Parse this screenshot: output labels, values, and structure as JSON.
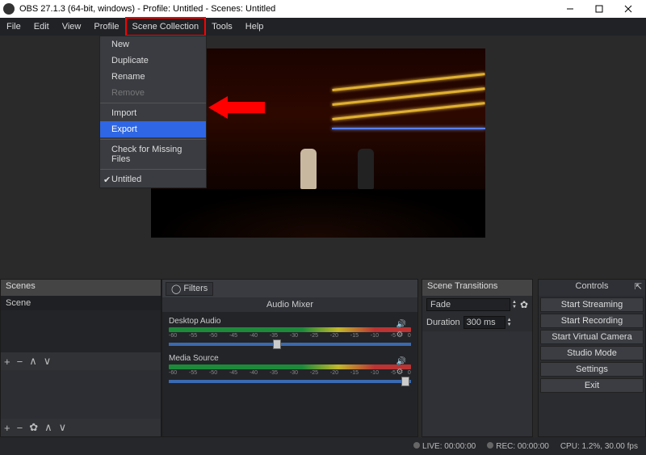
{
  "titlebar": {
    "title": "OBS 27.1.3 (64-bit, windows) - Profile: Untitled - Scenes: Untitled"
  },
  "menubar": {
    "items": [
      "File",
      "Edit",
      "View",
      "Profile",
      "Scene Collection",
      "Tools",
      "Help"
    ]
  },
  "dropdown": {
    "new": "New",
    "duplicate": "Duplicate",
    "rename": "Rename",
    "remove": "Remove",
    "import": "Import",
    "export": "Export",
    "check": "Check for Missing Files",
    "untitled": "Untitled"
  },
  "scenes": {
    "title": "Scenes",
    "items": [
      "Scene"
    ]
  },
  "mixer": {
    "filters_label": "Filters",
    "title": "Audio Mixer",
    "channels": [
      {
        "name": "Desktop Audio"
      },
      {
        "name": "Media Source"
      }
    ],
    "ticks": [
      "-60",
      "-55",
      "-50",
      "-45",
      "-40",
      "-35",
      "-30",
      "-25",
      "-20",
      "-15",
      "-10",
      "-5",
      "0"
    ]
  },
  "transitions": {
    "title": "Scene Transitions",
    "selected": "Fade",
    "duration_label": "Duration",
    "duration_value": "300 ms"
  },
  "controls": {
    "title": "Controls",
    "buttons": {
      "start_streaming": "Start Streaming",
      "start_recording": "Start Recording",
      "start_virtual_camera": "Start Virtual Camera",
      "studio_mode": "Studio Mode",
      "settings": "Settings",
      "exit": "Exit"
    }
  },
  "statusbar": {
    "live": "LIVE: 00:00:00",
    "rec": "REC: 00:00:00",
    "cpu": "CPU: 1.2%, 30.00 fps"
  }
}
